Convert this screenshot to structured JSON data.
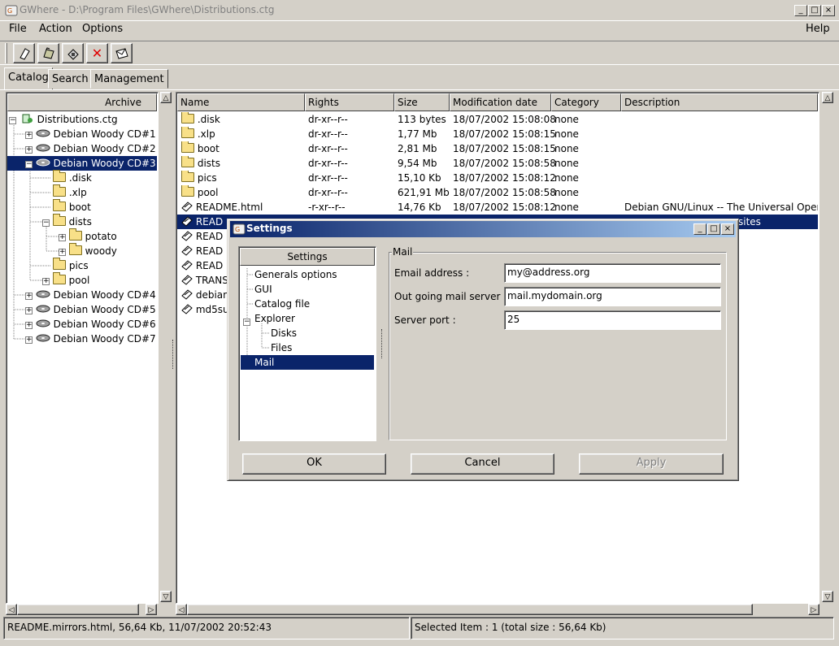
{
  "window": {
    "title": "GWhere - D:\\Program Files\\GWhere\\Distributions.ctg",
    "buttons": {
      "min": "_",
      "max": "□",
      "close": "×"
    }
  },
  "menu": {
    "file": "File",
    "action": "Action",
    "options": "Options",
    "help": "Help"
  },
  "toolbar": {
    "icons": [
      "new-catalog-icon",
      "open-catalog-icon",
      "save-catalog-icon",
      "close-catalog-icon",
      "mail-icon"
    ],
    "close_glyph": "✕"
  },
  "tabs": {
    "catalog": "Catalog",
    "search": "Search",
    "management": "Management"
  },
  "tree": {
    "header": "Archive",
    "root": "Distributions.ctg",
    "items": [
      {
        "label": "Debian Woody CD#1"
      },
      {
        "label": "Debian Woody CD#2"
      },
      {
        "label": "Debian Woody CD#3"
      },
      {
        "label": ".disk"
      },
      {
        "label": ".xlp"
      },
      {
        "label": "boot"
      },
      {
        "label": "dists"
      },
      {
        "label": "potato"
      },
      {
        "label": "woody"
      },
      {
        "label": "pics"
      },
      {
        "label": "pool"
      },
      {
        "label": "Debian Woody CD#4"
      },
      {
        "label": "Debian Woody CD#5"
      },
      {
        "label": "Debian Woody CD#6"
      },
      {
        "label": "Debian Woody CD#7"
      }
    ]
  },
  "list": {
    "columns": [
      "Name",
      "Rights",
      "Size",
      "Modification date",
      "Category",
      "Description"
    ],
    "rows": [
      {
        "name": ".disk",
        "rights": "dr-xr--r--",
        "size": "113 bytes",
        "date": "18/07/2002 15:08:08",
        "category": "none",
        "description": ""
      },
      {
        "name": ".xlp",
        "rights": "dr-xr--r--",
        "size": "1,77 Mb",
        "date": "18/07/2002 15:08:15",
        "category": "none",
        "description": ""
      },
      {
        "name": "boot",
        "rights": "dr-xr--r--",
        "size": "2,81 Mb",
        "date": "18/07/2002 15:08:15",
        "category": "none",
        "description": ""
      },
      {
        "name": "dists",
        "rights": "dr-xr--r--",
        "size": "9,54 Mb",
        "date": "18/07/2002 15:08:58",
        "category": "none",
        "description": ""
      },
      {
        "name": "pics",
        "rights": "dr-xr--r--",
        "size": "15,10 Kb",
        "date": "18/07/2002 15:08:12",
        "category": "none",
        "description": ""
      },
      {
        "name": "pool",
        "rights": "dr-xr--r--",
        "size": "621,91 Mb",
        "date": "18/07/2002 15:08:58",
        "category": "none",
        "description": ""
      },
      {
        "name": "README.html",
        "rights": "-r-xr--r--",
        "size": "14,76 Kb",
        "date": "18/07/2002 15:08:12",
        "category": "none",
        "description": "Debian GNU/Linux -- The Universal Opera"
      },
      {
        "name": "READ",
        "rights": "",
        "size": "",
        "date": "",
        "category": "",
        "description": "sites"
      },
      {
        "name": "READ",
        "rights": "",
        "size": "",
        "date": "",
        "category": "",
        "description": ""
      },
      {
        "name": "READ",
        "rights": "",
        "size": "",
        "date": "",
        "category": "",
        "description": ""
      },
      {
        "name": "READ",
        "rights": "",
        "size": "",
        "date": "",
        "category": "",
        "description": ""
      },
      {
        "name": "TRANS",
        "rights": "",
        "size": "",
        "date": "",
        "category": "",
        "description": ""
      },
      {
        "name": "debian",
        "rights": "",
        "size": "",
        "date": "",
        "category": "",
        "description": ""
      },
      {
        "name": "md5su",
        "rights": "",
        "size": "",
        "date": "",
        "category": "",
        "description": ""
      }
    ]
  },
  "status": {
    "left": "README.mirrors.html, 56,64 Kb, 11/07/2002 20:52:43",
    "right": "Selected Item : 1 (total size : 56,64 Kb)"
  },
  "dialog": {
    "title": "Settings",
    "tree_header": "Settings",
    "tree_items": [
      "Generals options",
      "GUI",
      "Catalog file",
      "Explorer",
      "Disks",
      "Files",
      "Mail"
    ],
    "group_label": "Mail",
    "email_label": "Email address :",
    "email_value": "my@address.org",
    "server_label": "Out going mail server :",
    "server_value": "mail.mydomain.org",
    "port_label": "Server port :",
    "port_value": "25",
    "ok": "OK",
    "cancel": "Cancel",
    "apply": "Apply"
  }
}
